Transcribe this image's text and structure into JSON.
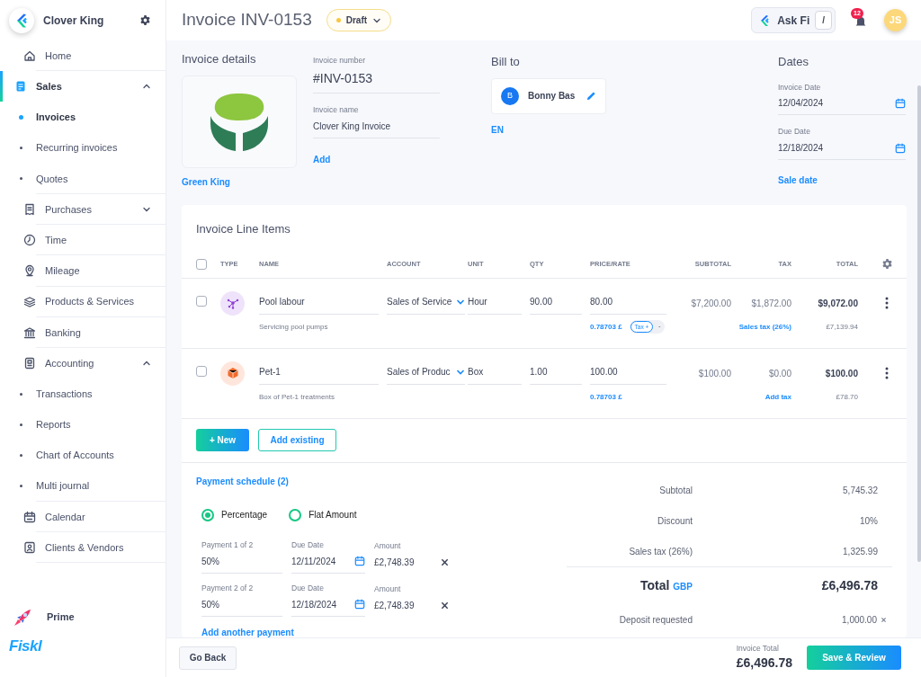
{
  "sidebar": {
    "brand": "Clover King",
    "items": [
      {
        "label": "Home",
        "selected": false
      },
      {
        "label": "Sales",
        "selected": true,
        "expanded": true,
        "children": [
          {
            "label": "Invoices",
            "selected": true
          },
          {
            "label": "Recurring invoices",
            "selected": false
          },
          {
            "label": "Quotes",
            "selected": false
          }
        ]
      },
      {
        "label": "Purchases",
        "selected": false,
        "expanded": false
      },
      {
        "label": "Time",
        "selected": false
      },
      {
        "label": "Mileage",
        "selected": false
      },
      {
        "label": "Products & Services",
        "selected": false
      },
      {
        "label": "Banking",
        "selected": false
      },
      {
        "label": "Accounting",
        "selected": false,
        "expanded": true,
        "children": [
          {
            "label": "Transactions",
            "selected": false
          },
          {
            "label": "Reports",
            "selected": false
          },
          {
            "label": "Chart of Accounts",
            "selected": false
          },
          {
            "label": "Multi journal",
            "selected": false
          }
        ]
      },
      {
        "label": "Calendar",
        "selected": false
      },
      {
        "label": "Clients & Vendors",
        "selected": false
      }
    ],
    "prime": "Prime",
    "wordmark": "Fiskl"
  },
  "header": {
    "title": "Invoice INV-0153",
    "status": "Draft",
    "ask": "Ask Fi",
    "ask_key": "/",
    "notifications": "12",
    "avatar": "JS"
  },
  "details": {
    "heading": "Invoice details",
    "logo_caption": "Green King",
    "invoice_number": {
      "label": "Invoice number",
      "value": "#INV-0153"
    },
    "invoice_name": {
      "label": "Invoice name",
      "value": "Clover King Invoice"
    },
    "add_link": "Add"
  },
  "bill_to": {
    "heading": "Bill to",
    "initial": "B",
    "client": "Bonny Bas",
    "language": "EN"
  },
  "dates": {
    "heading": "Dates",
    "invoice_date": {
      "label": "Invoice Date",
      "value": "12/04/2024"
    },
    "due_date": {
      "label": "Due Date",
      "value": "12/18/2024"
    },
    "sale_date_link": "Sale date"
  },
  "line_items": {
    "title": "Invoice Line Items",
    "header_checked": false,
    "columns": [
      "TYPE",
      "NAME",
      "ACCOUNT",
      "UNIT",
      "QTY",
      "PRICE/RATE",
      "SUBTOTAL",
      "TAX",
      "TOTAL"
    ],
    "rows": [
      {
        "kind": "service",
        "checked": false,
        "name": "Pool labour",
        "account": "Sales of Service",
        "unit": "Hour",
        "qty": "90.00",
        "price": "80.00",
        "subtotal": "$7,200.00",
        "tax": "$1,872.00",
        "total": "$9,072.00",
        "description": "Servicing pool pumps",
        "rate": "0.78703 £",
        "tax_chip": [
          "Tax +",
          "-"
        ],
        "tax_link": "Sales tax (26%)",
        "converted": "£7,139.94"
      },
      {
        "kind": "product",
        "checked": false,
        "name": "Pet-1",
        "account": "Sales of Produc",
        "unit": "Box",
        "qty": "1.00",
        "price": "100.00",
        "subtotal": "$100.00",
        "tax": "$0.00",
        "total": "$100.00",
        "description": "Box of Pet-1 treatments",
        "rate": "0.78703 £",
        "tax_link": "Add tax",
        "converted": "£78.70"
      }
    ],
    "new_button": "+ New",
    "existing_button": "Add existing"
  },
  "payment_schedule": {
    "title": "Payment schedule (2)",
    "options": [
      {
        "label": "Percentage",
        "selected": true
      },
      {
        "label": "Flat Amount",
        "selected": false
      }
    ],
    "payments": [
      {
        "label": "Payment 1 of 2",
        "value": "50%",
        "due_label": "Due Date",
        "due": "12/11/2024",
        "amount_label": "Amount",
        "amount": "£2,748.39"
      },
      {
        "label": "Payment 2 of 2",
        "value": "50%",
        "due_label": "Due Date",
        "due": "12/18/2024",
        "amount_label": "Amount",
        "amount": "£2,748.39"
      }
    ],
    "add_link": "Add another payment"
  },
  "summary": {
    "rows": [
      {
        "label": "Subtotal",
        "value": "5,745.32"
      },
      {
        "label": "Discount",
        "value": "10%"
      },
      {
        "label": "Sales tax (26%)",
        "value": "1,325.99"
      }
    ],
    "total_label": "Total",
    "currency": "GBP",
    "total": "£6,496.78",
    "deposit_label": "Deposit requested",
    "deposit": "1,000.00"
  },
  "footer": {
    "back": "Go Back",
    "total_label": "Invoice Total",
    "total": "£6,496.78",
    "save": "Save & Review"
  }
}
